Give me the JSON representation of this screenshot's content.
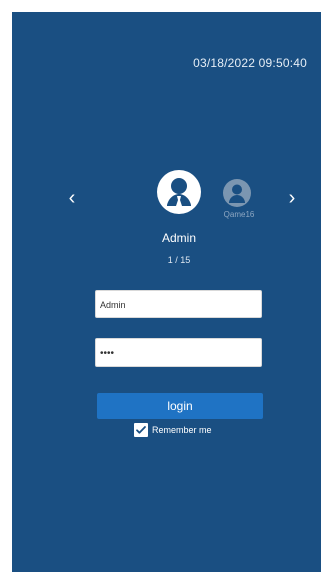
{
  "screen": {
    "datetime": "03/18/2022 09:50:40",
    "nav": {
      "prev_icon": "chevron-left-icon",
      "next_icon": "chevron-right-icon"
    },
    "users": {
      "primary_name": "Admin",
      "secondary_name": "Qame16",
      "index": "1 / 15"
    },
    "form": {
      "username_value": "Admin",
      "password_value": "••••",
      "login_label": "login",
      "remember_label": "Remember me",
      "remember_checked": true
    }
  }
}
